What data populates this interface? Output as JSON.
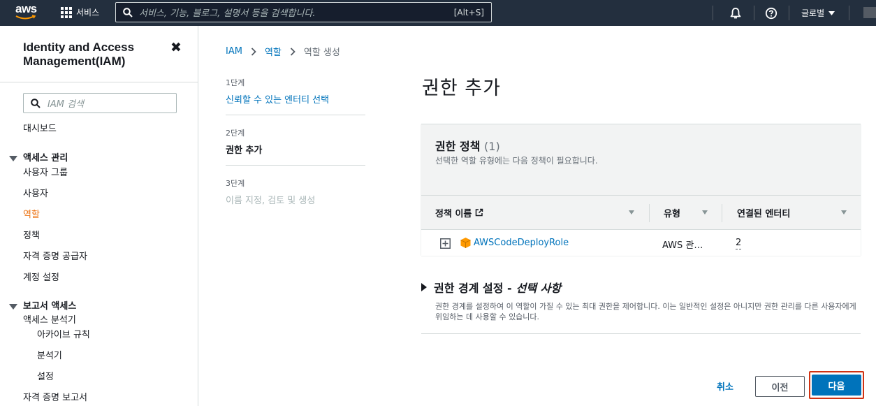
{
  "topbar": {
    "logo_text": "aws",
    "services_label": "서비스",
    "search_placeholder": "서비스, 기능, 블로그, 설명서 등을 검색합니다.",
    "search_shortcut": "[Alt+S]",
    "region_label": "글로벌"
  },
  "sidebar": {
    "title": "Identity and Access Management(IAM)",
    "search_placeholder": "IAM 검색",
    "dashboard": "대시보드",
    "access_mgmt_header": "액세스 관리",
    "access_items": [
      "사용자 그룹",
      "사용자",
      "역할",
      "정책",
      "자격 증명 공급자",
      "계정 설정"
    ],
    "active_item": "역할",
    "report_header": "보고서 액세스",
    "access_analyzer": "액세스 분석기",
    "analyzer_items": [
      "아카이브 규칙",
      "분석기",
      "설정"
    ],
    "credential_report": "자격 증명 보고서"
  },
  "breadcrumb": [
    "IAM",
    "역할",
    "역할 생성"
  ],
  "steps": [
    {
      "label": "1단계",
      "title": "신뢰할 수 있는 엔터티 선택",
      "state": "link"
    },
    {
      "label": "2단계",
      "title": "권한 추가",
      "state": "current"
    },
    {
      "label": "3단계",
      "title": "이름 지정, 검토 및 생성",
      "state": "disabled"
    }
  ],
  "page_title": "권한 추가",
  "policies": {
    "title": "권한 정책",
    "count": "(1)",
    "description": "선택한 역할 유형에는 다음 정책이 필요합니다.",
    "columns": [
      "정책 이름",
      "유형",
      "연결된 엔터티"
    ],
    "rows": [
      {
        "name": "AWSCodeDeployRole",
        "type": "AWS 관…",
        "entities": "2"
      }
    ]
  },
  "boundary": {
    "title": "권한 경계 설정 -",
    "optional": "선택 사항",
    "description": "권한 경계를 설정하여 이 역할이 가질 수 있는 최대 권한을 제어합니다. 이는 일반적인 설정은 아니지만 권한 관리를 다른 사용자에게 위임하는 데 사용할 수 있습니다."
  },
  "actions": {
    "cancel": "취소",
    "previous": "이전",
    "next": "다음"
  },
  "colors": {
    "topbar_bg": "#232f3e",
    "link": "#0073bb",
    "active_nav": "#ec7211",
    "primary_button": "#0073bb",
    "highlight_border": "#d13212"
  }
}
